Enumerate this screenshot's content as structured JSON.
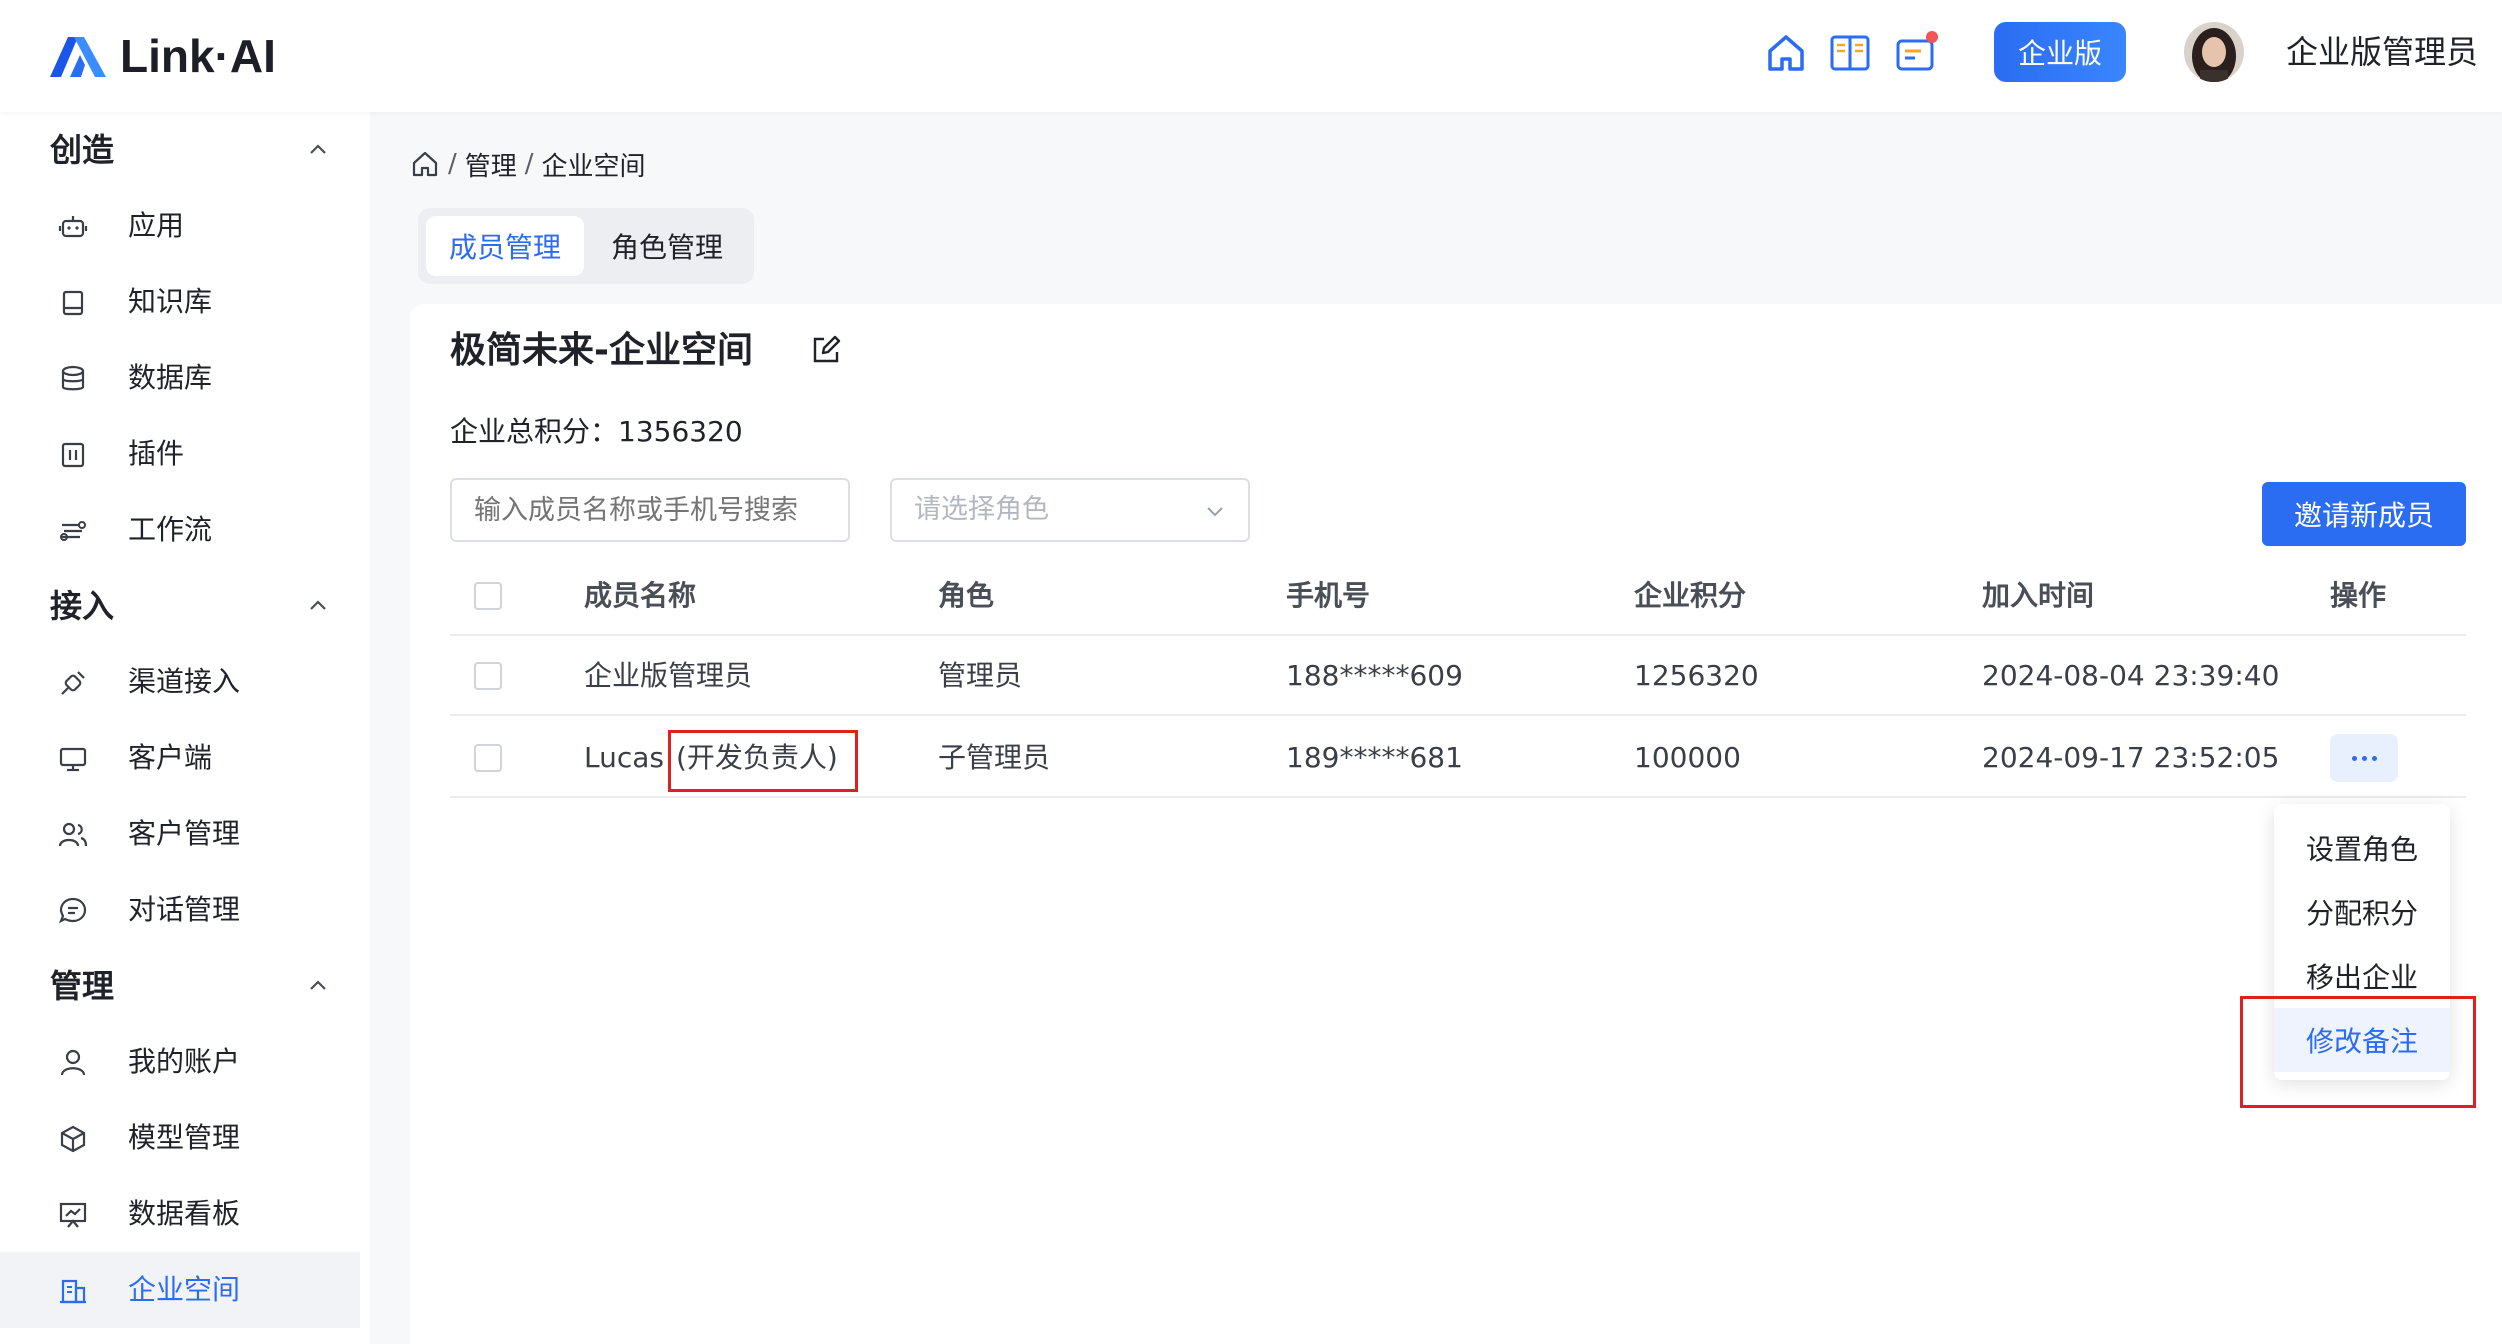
{
  "header": {
    "logo_text": "Link·AI",
    "icons": [
      "home-icon",
      "book-icon",
      "message-icon"
    ],
    "enterprise_label": "企业版",
    "user_name": "企业版管理员"
  },
  "sidebar": {
    "sections": [
      {
        "title": "创造",
        "items": [
          {
            "label": "应用",
            "icon": "robot-icon"
          },
          {
            "label": "知识库",
            "icon": "book-icon"
          },
          {
            "label": "数据库",
            "icon": "database-icon"
          },
          {
            "label": "插件",
            "icon": "plugin-icon"
          },
          {
            "label": "工作流",
            "icon": "workflow-icon"
          }
        ]
      },
      {
        "title": "接入",
        "items": [
          {
            "label": "渠道接入",
            "icon": "plug-icon"
          },
          {
            "label": "客户端",
            "icon": "monitor-icon"
          },
          {
            "label": "客户管理",
            "icon": "users-icon"
          },
          {
            "label": "对话管理",
            "icon": "chat-icon"
          }
        ]
      },
      {
        "title": "管理",
        "items": [
          {
            "label": "我的账户",
            "icon": "user-icon"
          },
          {
            "label": "模型管理",
            "icon": "cube-icon"
          },
          {
            "label": "数据看板",
            "icon": "dashboard-icon"
          },
          {
            "label": "企业空间",
            "icon": "building-icon",
            "active": true
          }
        ]
      }
    ]
  },
  "breadcrumb": {
    "items": [
      "管理",
      "企业空间"
    ]
  },
  "tabs": [
    {
      "label": "成员管理",
      "active": true
    },
    {
      "label": "角色管理",
      "active": false
    }
  ],
  "space": {
    "title": "极简未来-企业空间",
    "points_label": "企业总积分：",
    "points_value": "1356320"
  },
  "filters": {
    "search_placeholder": "输入成员名称或手机号搜索",
    "role_placeholder": "请选择角色",
    "invite_label": "邀请新成员"
  },
  "table": {
    "columns": [
      "成员名称",
      "角色",
      "手机号",
      "企业积分",
      "加入时间",
      "操作"
    ],
    "rows": [
      {
        "name": "企业版管理员",
        "note": "",
        "role": "管理员",
        "phone": "188*****609",
        "points": "1256320",
        "joined": "2024-08-04 23:39:40"
      },
      {
        "name": "Lucas",
        "note": "(开发负责人)",
        "role": "子管理员",
        "phone": "189*****681",
        "points": "100000",
        "joined": "2024-09-17 23:52:05"
      }
    ]
  },
  "dropdown": {
    "items": [
      {
        "label": "设置角色"
      },
      {
        "label": "分配积分"
      },
      {
        "label": "移出企业"
      },
      {
        "label": "修改备注",
        "active": true
      }
    ]
  },
  "colors": {
    "accent": "#2a6cf2",
    "highlight": "#e02020"
  }
}
